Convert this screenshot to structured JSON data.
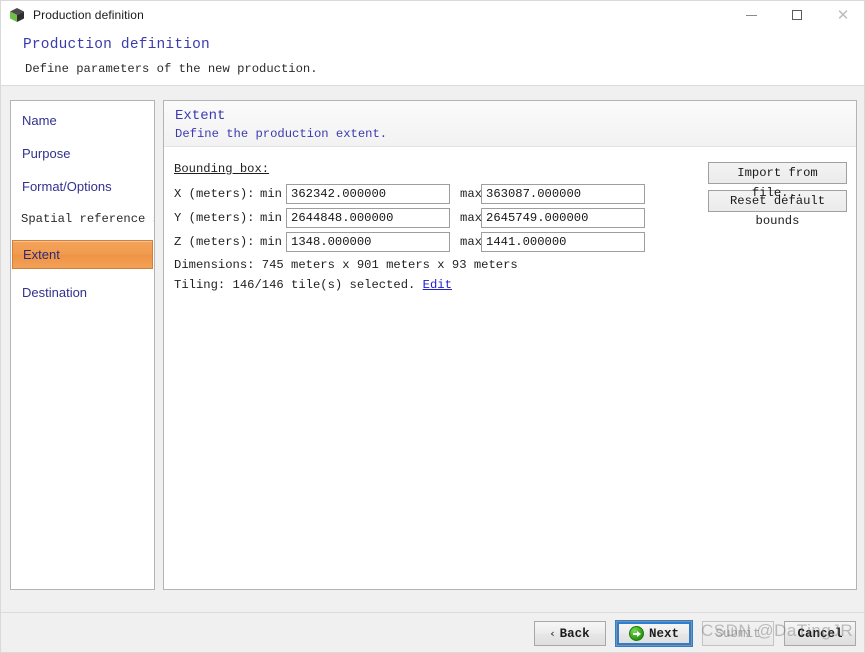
{
  "window": {
    "title": "Production definition",
    "icon": "cube-icon",
    "controls": {
      "minimize": "–",
      "maximize": "□",
      "close": "✕"
    }
  },
  "banner": {
    "title": "Production definition",
    "subtitle": "Define parameters of the new production."
  },
  "sidebar": {
    "items": [
      {
        "label": "Name",
        "selected": false,
        "mono": false
      },
      {
        "label": "Purpose",
        "selected": false,
        "mono": false
      },
      {
        "label": "Format/Options",
        "selected": false,
        "mono": false
      },
      {
        "label": "Spatial reference sy",
        "selected": false,
        "mono": true
      },
      {
        "label": "Extent",
        "selected": true,
        "mono": false
      },
      {
        "label": "Destination",
        "selected": false,
        "mono": false
      }
    ],
    "selected_color": "#f09b4f"
  },
  "content": {
    "title": "Extent",
    "subtitle": "Define the production extent.",
    "bounding_box_label": "Bounding box:",
    "min_label": "min",
    "max_label": "max",
    "rows": [
      {
        "axis": "X (meters):",
        "min": "362342.000000",
        "max": "363087.000000"
      },
      {
        "axis": "Y (meters):",
        "min": "2644848.000000",
        "max": "2645749.000000"
      },
      {
        "axis": "Z (meters):",
        "min": "1348.000000",
        "max": "1441.000000"
      }
    ],
    "dimensions": "Dimensions: 745 meters x 901 meters x 93 meters",
    "tiling_text": "Tiling: 146/146 tile(s) selected. ",
    "tiling_edit_link": "Edit",
    "actions": [
      {
        "label": "Import from file..."
      },
      {
        "label": "Reset default bounds"
      }
    ]
  },
  "footer": {
    "back": "Back",
    "back_chevron": "‹",
    "next": "Next",
    "submit": "Submit",
    "cancel": "Cancel"
  },
  "watermark": {
    "text": "CSDN @DaTingJR"
  }
}
